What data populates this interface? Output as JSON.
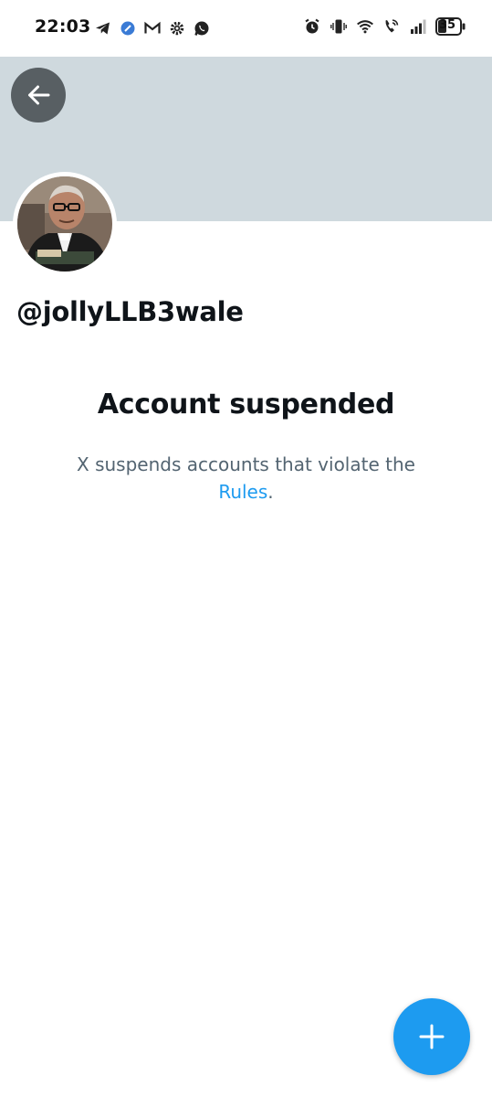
{
  "status_bar": {
    "time": "22:03",
    "battery_level": "35",
    "left_icons": [
      "telegram-icon",
      "app-icon",
      "gmail-icon",
      "settings-icon",
      "whatsapp-icon"
    ],
    "right_icons": [
      "alarm-icon",
      "vibrate-icon",
      "wifi-icon",
      "wifi-call-icon",
      "signal-icon",
      "battery-icon"
    ]
  },
  "profile": {
    "handle": "@jollyLLB3wale",
    "banner_color": "#cfd9de"
  },
  "suspension": {
    "title": "Account suspended",
    "message": "X suspends accounts that violate the",
    "link_text": "Rules",
    "message_end": "."
  },
  "colors": {
    "accent": "#1d9bf0",
    "secondary_text": "#536471",
    "primary_text": "#0f1419"
  },
  "fab": {
    "icon": "plus-icon"
  }
}
